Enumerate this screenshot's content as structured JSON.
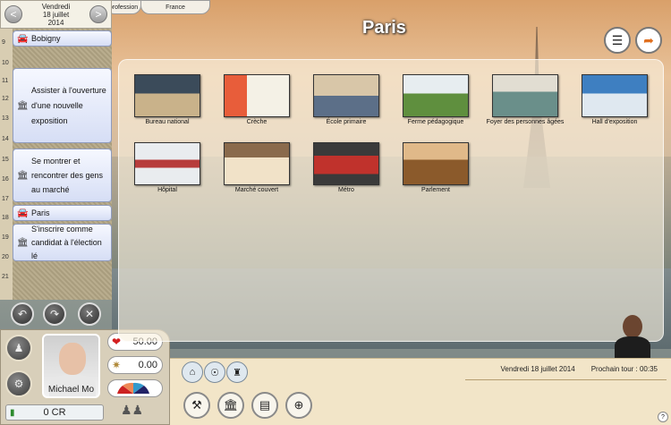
{
  "top_tabs": [
    "profession",
    "France"
  ],
  "date": {
    "weekday": "Vendredi",
    "day_month": "18 juillet",
    "year": "2014",
    "prev": "<",
    "next": ">"
  },
  "agenda": {
    "hours": [
      "9",
      "10",
      "11",
      "12",
      "13",
      "14",
      "15",
      "16",
      "17",
      "18",
      "19",
      "20",
      "21"
    ],
    "events": [
      {
        "label": "Bobigny",
        "icon": "car-icon"
      },
      {
        "label": "Assister à l'ouverture d'une nouvelle exposition",
        "icon": "institution-icon"
      },
      {
        "label": "Se montrer et rencontrer des gens au marché",
        "icon": "institution-icon"
      },
      {
        "label": "Paris",
        "icon": "car-icon"
      },
      {
        "label": "S'inscrire comme candidat à l'élection lé",
        "icon": "institution-icon"
      }
    ]
  },
  "controls": {
    "undo_icon": "undo-icon",
    "redo_icon": "redo-icon",
    "cancel_icon": "close-icon"
  },
  "player": {
    "name": "Michael Mo",
    "health": "50.00",
    "popularity": "0.00",
    "money": "0 CR"
  },
  "page": {
    "title": "Paris"
  },
  "locations": [
    {
      "label": "Bureau national",
      "colors": [
        "#3b4b5a",
        "#c9b28a"
      ]
    },
    {
      "label": "Crèche",
      "colors": [
        "#e85d3a",
        "#f4f1e6"
      ]
    },
    {
      "label": "École primaire",
      "colors": [
        "#d8c6a8",
        "#5c6f88"
      ]
    },
    {
      "label": "Ferme pédagogique",
      "colors": [
        "#5f8f3e",
        "#e7edf0"
      ]
    },
    {
      "label": "Foyer des personnes âgées",
      "colors": [
        "#6a8f8a",
        "#e1ddd2"
      ]
    },
    {
      "label": "Hall d'exposition",
      "colors": [
        "#3e7fc1",
        "#dfe8f0"
      ]
    },
    {
      "label": "Hôpital",
      "colors": [
        "#b73c3c",
        "#e9ecef"
      ]
    },
    {
      "label": "Marché couvert",
      "colors": [
        "#8a6a4c",
        "#f1e2c8"
      ]
    },
    {
      "label": "Métro",
      "colors": [
        "#c0322c",
        "#3a3a3a"
      ]
    },
    {
      "label": "Parlement",
      "colors": [
        "#8b5a2b",
        "#e0b989"
      ]
    }
  ],
  "status": {
    "date": "Vendredi 18 juillet 2014",
    "next_turn": "Prochain tour : 00:35"
  },
  "help": "?"
}
